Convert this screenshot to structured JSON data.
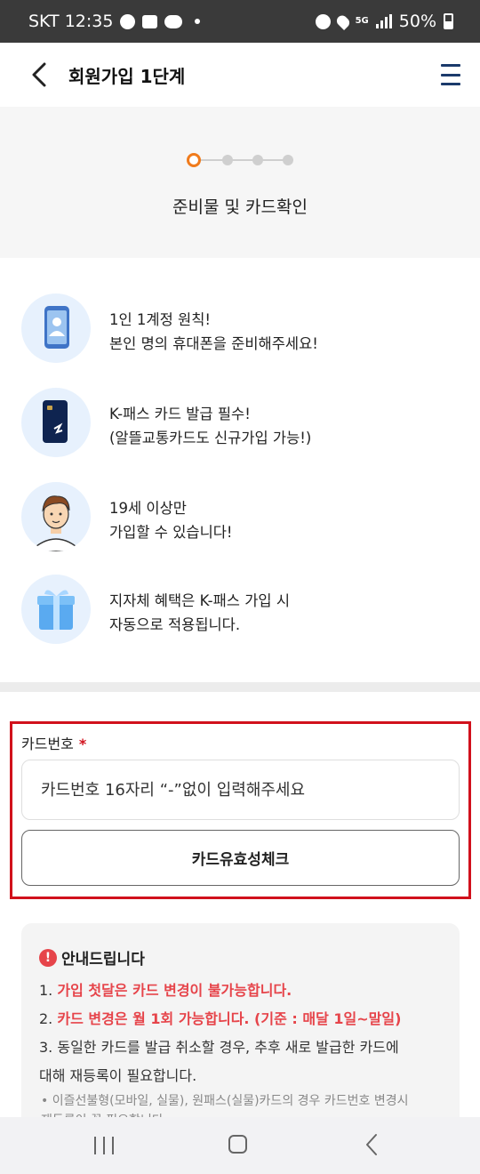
{
  "status_bar": {
    "carrier_time": "SKT 12:35",
    "network": "5G",
    "battery": "50%"
  },
  "header": {
    "title": "회원가입 1단계"
  },
  "steps": {
    "current": 1,
    "total": 4,
    "label": "준비물 및 카드확인"
  },
  "requirements": [
    {
      "icon": "phone-icon",
      "line1": "1인 1계정 원칙!",
      "line2": "본인 명의 휴대폰을 준비해주세요!"
    },
    {
      "icon": "card-icon",
      "line1": "K-패스 카드 발급 필수!",
      "line2": "(알뜰교통카드도 신규가입 가능!)"
    },
    {
      "icon": "person-icon",
      "line1": "19세 이상만",
      "line2": "가입할 수 있습니다!"
    },
    {
      "icon": "gift-icon",
      "line1": "지자체 혜택은 K-패스 가입 시",
      "line2": "자동으로 적용됩니다."
    }
  ],
  "card_form": {
    "label": "카드번호",
    "required_mark": "*",
    "placeholder": "카드번호 16자리 “-”없이 입력해주세요",
    "check_button": "카드유효성체크"
  },
  "notice": {
    "title": "안내드립니다",
    "item1_num": "1.",
    "item1_text": "가입 첫달은 카드 변경이 불가능합니다.",
    "item2_num": "2.",
    "item2_text": "카드 변경은 월 1회 가능합니다. (기준 : 매달 1일~말일)",
    "item3_line1": "3. 동일한 카드를 발급 취소할 경우, 추후 새로 발급한 카드에",
    "item3_line2": "대해 재등록이 필요합니다.",
    "sub_line1": "• 이즐선불형(모바일, 실물), 원패스(실물)카드의 경우 카드번호 변경시",
    "sub_line2": "재등록이 꼭 필요합니다."
  },
  "colors": {
    "accent_orange": "#f07b1c",
    "highlight_red": "#d1111c",
    "notice_red": "#e6444a",
    "menu_navy": "#1b3a6b"
  }
}
